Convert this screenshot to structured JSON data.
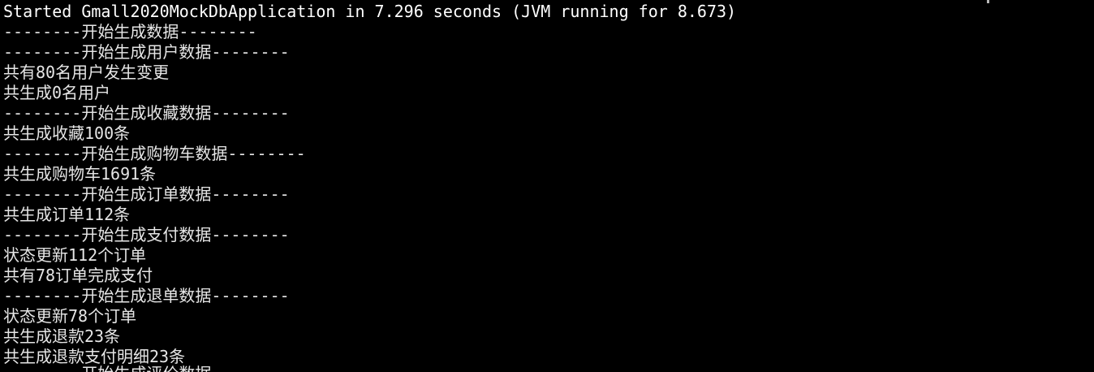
{
  "terminal": {
    "background": "#000000",
    "foreground": "#e6e6e6",
    "lines": [
      "Started Gmall2020MockDbApplication in 7.296 seconds (JVM running for 8.673)",
      "--------开始生成数据--------",
      "--------开始生成用户数据--------",
      "共有80名用户发生变更",
      "共生成0名用户",
      "--------开始生成收藏数据--------",
      "共生成收藏100条",
      "--------开始生成购物车数据--------",
      "共生成购物车1691条",
      "--------开始生成订单数据--------",
      "共生成订单112条",
      "--------开始生成支付数据--------",
      "状态更新112个订单",
      "共有78订单完成支付",
      "--------开始生成退单数据--------",
      "状态更新78个订单",
      "共生成退款23条",
      "共生成退款支付明细23条",
      "--------开始生成评价数据--------"
    ]
  }
}
